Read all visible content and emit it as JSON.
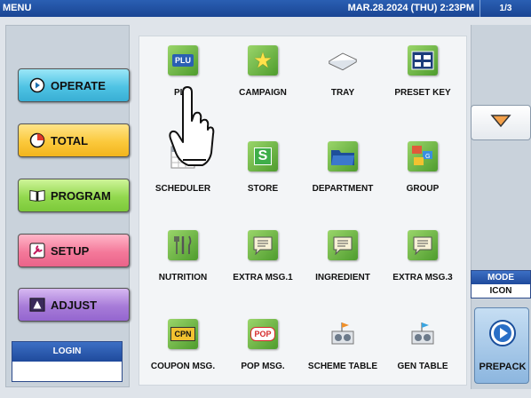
{
  "topbar": {
    "menu": "MENU",
    "datetime": "MAR.28.2024 (THU)  2:23PM",
    "page": "1/3"
  },
  "nav": [
    {
      "label": "OPERATE",
      "icon": "operate-icon"
    },
    {
      "label": "TOTAL",
      "icon": "total-icon"
    },
    {
      "label": "PROGRAM",
      "icon": "program-icon"
    },
    {
      "label": "SETUP",
      "icon": "setup-icon"
    },
    {
      "label": "ADJUST",
      "icon": "adjust-icon"
    }
  ],
  "login": {
    "label": "LOGIN",
    "value": ""
  },
  "tiles": [
    {
      "label": "PLU",
      "icon": "plu-icon",
      "glyph": "PLU"
    },
    {
      "label": "CAMPAIGN",
      "icon": "star-icon",
      "glyph": "★"
    },
    {
      "label": "TRAY",
      "icon": "tray-icon",
      "glyph": ""
    },
    {
      "label": "PRESET KEY",
      "icon": "keyboard-icon",
      "glyph": "▦"
    },
    {
      "label": "SCHEDULER",
      "icon": "calendar-icon",
      "glyph": ""
    },
    {
      "label": "STORE",
      "icon": "store-icon",
      "glyph": "S"
    },
    {
      "label": "DEPARTMENT",
      "icon": "folder-icon",
      "glyph": ""
    },
    {
      "label": "GROUP",
      "icon": "group-icon",
      "glyph": "G"
    },
    {
      "label": "NUTRITION",
      "icon": "cutlery-icon",
      "glyph": "🍴"
    },
    {
      "label": "EXTRA MSG.1",
      "icon": "message-icon",
      "glyph": "≡"
    },
    {
      "label": "INGREDIENT",
      "icon": "message-icon",
      "glyph": "≡"
    },
    {
      "label": "EXTRA MSG.3",
      "icon": "message-icon",
      "glyph": "≡"
    },
    {
      "label": "COUPON MSG.",
      "icon": "coupon-icon",
      "glyph": "CPN"
    },
    {
      "label": "POP MSG.",
      "icon": "pop-icon",
      "glyph": "POP"
    },
    {
      "label": "SCHEME TABLE",
      "icon": "scheme-table-icon",
      "glyph": ""
    },
    {
      "label": "GEN TABLE",
      "icon": "gen-table-icon",
      "glyph": ""
    }
  ],
  "mode": {
    "label": "MODE",
    "value": "ICON"
  },
  "prepack": {
    "label": "PREPACK"
  },
  "colors": {
    "topbar": "#1a4593",
    "accent_blue": "#2b4a8a",
    "tile_green": "#4e9c2d"
  }
}
